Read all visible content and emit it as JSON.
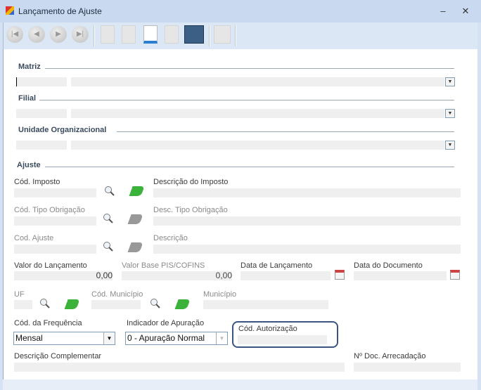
{
  "window": {
    "title": "Lançamento de Ajuste",
    "minimize": "‒",
    "close": "✕"
  },
  "sections": {
    "matriz": "Matriz",
    "filial": "Filial",
    "unidade": "Unidade Organizacional",
    "ajuste": "Ajuste"
  },
  "fields": {
    "cod_imposto": "Cód. Imposto",
    "desc_imposto": "Descrição do Imposto",
    "cod_tipo_obrig": "Cód. Tipo Obrigação",
    "desc_tipo_obrig": "Desc. Tipo Obrigação",
    "cod_ajuste": "Cod. Ajuste",
    "descricao": "Descrição",
    "valor_lanc": "Valor do Lançamento",
    "valor_lanc_value": "0,00",
    "valor_base": "Valor Base PIS/COFINS",
    "valor_base_value": "0,00",
    "data_lanc": "Data de Lançamento",
    "data_doc": "Data do Documento",
    "uf": "UF",
    "cod_municipio": "Cód. Município",
    "municipio": "Município",
    "cod_freq": "Cód. da Frequência",
    "cod_freq_value": "Mensal",
    "ind_apuracao": "Indicador de Apuração",
    "ind_apuracao_value": "0 - Apuração Normal",
    "cod_autorizacao": "Cód. Autorização",
    "desc_compl": "Descrição Complementar",
    "num_doc": "Nº Doc. Arrecadação"
  }
}
